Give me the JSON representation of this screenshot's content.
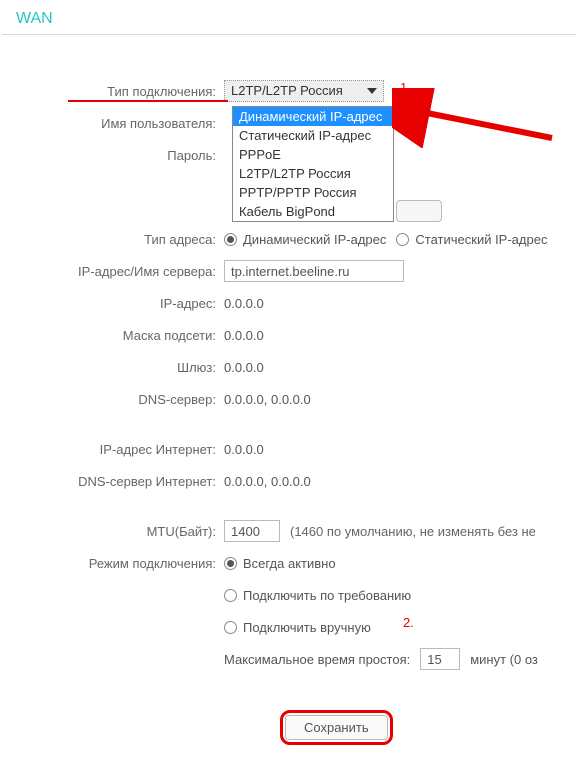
{
  "title": "WAN",
  "labels": {
    "conn_type": "Тип подключения:",
    "username": "Имя пользователя:",
    "password": "Пароль:",
    "addr_type": "Тип адреса:",
    "ip_server": "IP-адрес/Имя сервера:",
    "ip_addr": "IP-адрес:",
    "mask": "Маска подсети:",
    "gateway": "Шлюз:",
    "dns": "DNS-сервер:",
    "inet_ip": "IP-адрес Интернет:",
    "inet_dns": "DNS-сервер Интернет:",
    "mtu": "MTU(Байт):",
    "conn_mode": "Режим подключения:",
    "max_idle": "Максимальное время простоя:"
  },
  "select": {
    "current": "L2TP/L2TP Россия",
    "options": [
      "Динамический IP-адрес",
      "Статический IP-адрес",
      "PPPoE",
      "L2TP/L2TP Россия",
      "PPTP/PPTP Россия",
      "Кабель BigPond"
    ],
    "highlighted_index": 0
  },
  "addr_radio": {
    "dyn": "Динамический IP-адрес",
    "stat": "Статический IP-адрес"
  },
  "server_value": "tp.internet.beeline.ru",
  "ip_value": "0.0.0.0",
  "mask_value": "0.0.0.0",
  "gw_value": "0.0.0.0",
  "dns_value": "0.0.0.0,   0.0.0.0",
  "inet_ip_value": "0.0.0.0",
  "inet_dns_value": "0.0.0.0,   0.0.0.0",
  "mtu_value": "1400",
  "mtu_hint": "(1460 по умолчанию, не изменять без не",
  "mode": {
    "always": "Всегда активно",
    "demand": "Подключить по требованию",
    "manual": "Подключить вручную"
  },
  "idle_value": "15",
  "idle_unit": "минут (0 оз",
  "save_label": "Сохранить",
  "annot1": "1.",
  "annot2": "2."
}
